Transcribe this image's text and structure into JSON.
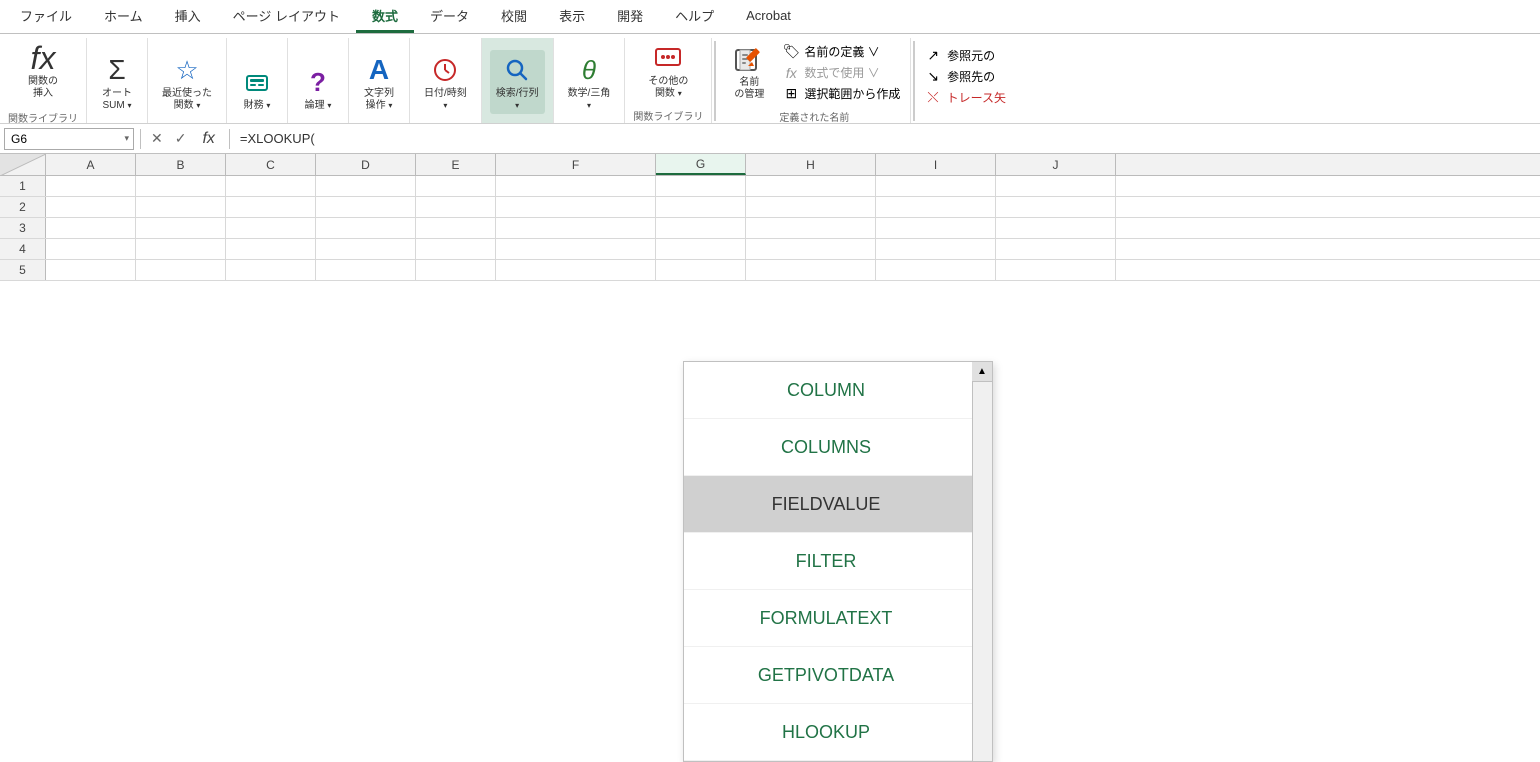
{
  "tabs": [
    {
      "label": "ファイル",
      "active": false
    },
    {
      "label": "ホーム",
      "active": false
    },
    {
      "label": "挿入",
      "active": false
    },
    {
      "label": "ページ レイアウト",
      "active": false
    },
    {
      "label": "数式",
      "active": true
    },
    {
      "label": "データ",
      "active": false
    },
    {
      "label": "校閲",
      "active": false
    },
    {
      "label": "表示",
      "active": false
    },
    {
      "label": "開発",
      "active": false
    },
    {
      "label": "ヘルプ",
      "active": false
    },
    {
      "label": "Acrobat",
      "active": false
    }
  ],
  "ribbon": {
    "group_function_library": "関数ライブラリ",
    "group_defined_names": "定義された名前",
    "btn_insert_function": {
      "icon": "fx",
      "line1": "関数の",
      "line2": "挿入"
    },
    "btn_auto_sum": {
      "icon": "Σ",
      "line1": "オート",
      "line2": "SUM ∨"
    },
    "btn_recent": {
      "icon": "☆",
      "line1": "最近使った",
      "line2": "関数 ∨"
    },
    "btn_financial": {
      "icon": "🗄",
      "line1": "財務",
      "line2": "∨"
    },
    "btn_logical": {
      "icon": "?",
      "line1": "論理",
      "line2": "∨"
    },
    "btn_text": {
      "icon": "A",
      "line1": "文字列",
      "line2": "操作 ∨"
    },
    "btn_datetime": {
      "icon": "⏱",
      "line1": "日付/時刻",
      "line2": "∨"
    },
    "btn_lookup": {
      "icon": "🔍",
      "line1": "検索/行列",
      "line2": "∨"
    },
    "btn_math": {
      "icon": "θ",
      "line1": "数学/三角",
      "line2": "∨"
    },
    "btn_other": {
      "icon": "···",
      "line1": "その他の",
      "line2": "関数 ∨"
    },
    "btn_name_manager": {
      "icon": "🏷",
      "line1": "名前",
      "line2": "の管理"
    },
    "btn_define_name": "名前の定義 ∨",
    "btn_use_in_formula": "数式で使用 ∨",
    "btn_create_from_selection": "選択範囲から作成",
    "btn_trace_precedents": "参照元の",
    "btn_trace_dependents": "参照先の",
    "btn_trace_error": "トレース矢"
  },
  "formula_bar": {
    "cell_ref": "G6",
    "formula": "=XLOOKUP("
  },
  "columns": [
    "A",
    "B",
    "C",
    "D",
    "E",
    "F",
    "G",
    "H",
    "I",
    "J"
  ],
  "rows": [
    "1",
    "2",
    "3",
    "4",
    "5"
  ],
  "dropdown": {
    "items": [
      {
        "label": "COLUMN",
        "highlighted": false
      },
      {
        "label": "COLUMNS",
        "highlighted": false
      },
      {
        "label": "FIELDVALUE",
        "highlighted": true
      },
      {
        "label": "FILTER",
        "highlighted": false
      },
      {
        "label": "FORMULATEXT",
        "highlighted": false
      },
      {
        "label": "GETPIVOTDATA",
        "highlighted": false
      },
      {
        "label": "HLOOKUP",
        "highlighted": false
      }
    ]
  }
}
